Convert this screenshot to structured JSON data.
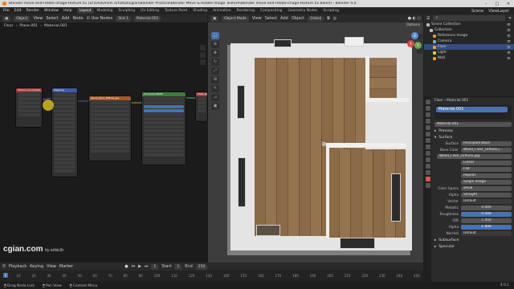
{
  "window": {
    "title": "Blender move-and-rotate-image-texture 01 (D:\\OneDrive\\ artistLb\\cgian\\Blender Practice\\Blender Move & Rotate Image Texture\\Blender move-and-rotate-image-texture 01.blend) - Blender 4.0",
    "buttons": [
      "–",
      "□",
      "×"
    ]
  },
  "menu": {
    "items": [
      "File",
      "Edit",
      "Render",
      "Window",
      "Help"
    ],
    "workspaces": [
      "Layout",
      "Modeling",
      "Sculpting",
      "UV Editing",
      "Texture Paint",
      "Shading",
      "Animation",
      "Rendering",
      "Compositing",
      "Geometry Nodes",
      "Scripting"
    ],
    "active_workspace": "Layout",
    "scene": "Scene",
    "view_layer": "ViewLayer"
  },
  "node_editor": {
    "header": {
      "editor": "Object",
      "view": "View",
      "select": "Select",
      "add": "Add",
      "node": "Node",
      "use_nodes": "Use Nodes",
      "slot": "Slot 1",
      "material": "Material.001"
    },
    "breadcrumb": [
      "Floor",
      "Plane.001",
      "Material.001"
    ],
    "nodes": {
      "texcoord": "Texture Coordinate",
      "mapping": "Mapping",
      "image": "Wood_Floor_Diffuse.jpg",
      "bsdf": "Principled BSDF",
      "output": "Material Output"
    }
  },
  "watermark": {
    "brand": "cgian.com",
    "by": "by artist.lb"
  },
  "viewport": {
    "header": {
      "mode": "Object Mode",
      "view": "View",
      "select": "Select",
      "add": "Add",
      "object": "Object",
      "transform": "Global"
    },
    "options": "Options",
    "gizmo": {
      "x": "X",
      "y": "Y",
      "z": "Z"
    }
  },
  "timeline": {
    "menus": [
      "Playback",
      "Keying",
      "View",
      "Marker"
    ],
    "start_label": "Start",
    "start": "1",
    "end_label": "End",
    "end": "250",
    "current": "1",
    "ticks": [
      "0",
      "10",
      "20",
      "30",
      "40",
      "50",
      "60",
      "70",
      "80",
      "90",
      "100",
      "110",
      "120",
      "130",
      "140",
      "150",
      "160",
      "170",
      "180",
      "190",
      "200",
      "210",
      "220",
      "230",
      "240",
      "250"
    ]
  },
  "status_bar": {
    "items": [
      "Drag Node Link",
      "Pan View",
      "Context Menu"
    ],
    "version": "4.0.1"
  },
  "outliner": {
    "title": "Scene Collection",
    "items": [
      {
        "label": "Scene Collection",
        "color": "#bbbbbb",
        "selected": false
      },
      {
        "label": "Collection",
        "color": "#bbbbbb",
        "selected": false
      },
      {
        "label": "Reference Image",
        "color": "#d99a3b",
        "selected": false
      },
      {
        "label": "Camera",
        "color": "#7fa6de",
        "selected": false
      },
      {
        "label": "Floor",
        "color": "#e39a3c",
        "selected": true
      },
      {
        "label": "Light",
        "color": "#e8c547",
        "selected": false
      },
      {
        "label": "Wall",
        "color": "#e39a3c",
        "selected": false
      }
    ]
  },
  "properties": {
    "breadcrumb": [
      "Floor",
      "Material.001"
    ],
    "material_slot": "Material.001",
    "material_name": "Material.001",
    "sections": {
      "preview": "Preview",
      "surface": "Surface"
    },
    "surface_label": "Surface",
    "surface_value": "Principled BSDF",
    "base_color_label": "Base Color",
    "base_color_value": "Wood_Floor_Diffuse.j...",
    "image_file": "Wood_Floor_Diffuse.jpg",
    "interpolation": "Linear",
    "projection": "Flat",
    "extension": "Repeat",
    "source": "Single Image",
    "color_space_label": "Color Space",
    "color_space": "sRGB",
    "alpha_label": "Alpha",
    "alpha": "Straight",
    "vector_label": "Vector",
    "vector": "Default",
    "metallic_label": "Metallic",
    "metallic": "0.000",
    "roughness_label": "Roughness",
    "roughness": "0.500",
    "ior_label": "IOR",
    "ior": "1.450",
    "alpha2_label": "Alpha",
    "alpha2": "1.000",
    "normal_label": "Normal",
    "normal": "Default",
    "subsurface": "Subsurface",
    "specular": "Specular"
  }
}
